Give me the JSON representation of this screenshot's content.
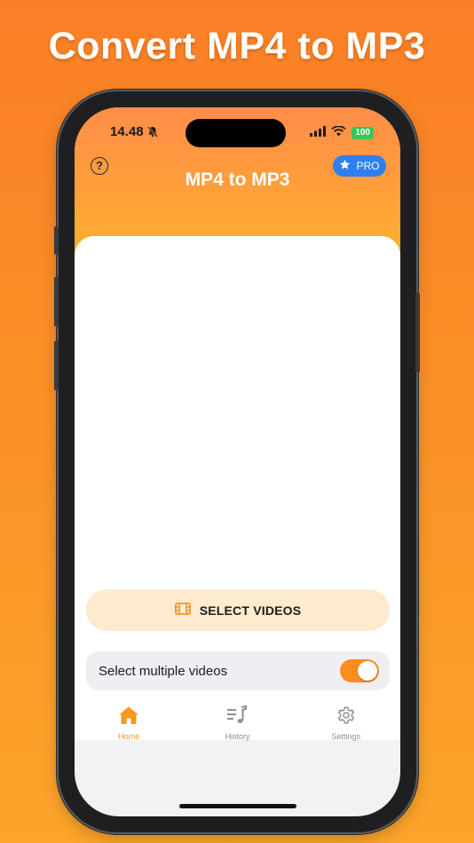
{
  "headline": "Convert MP4 to MP3",
  "status_bar": {
    "time": "14.48",
    "battery": "100"
  },
  "header": {
    "title": "MP4 to MP3",
    "help_icon": "?",
    "pro_label": "PRO"
  },
  "select_button": {
    "label": "SELECT VIDEOS",
    "icon": "film-icon"
  },
  "multi_select": {
    "label": "Select multiple videos",
    "enabled": true
  },
  "tabs": [
    {
      "label": "Home",
      "icon": "house-icon",
      "active": true
    },
    {
      "label": "History",
      "icon": "music-list-icon",
      "active": false
    },
    {
      "label": "Settings",
      "icon": "gear-icon",
      "active": false
    }
  ],
  "colors": {
    "accent": "#fb8c1e",
    "pro": "#2f7ff0",
    "button_bg": "#fdebd0"
  }
}
